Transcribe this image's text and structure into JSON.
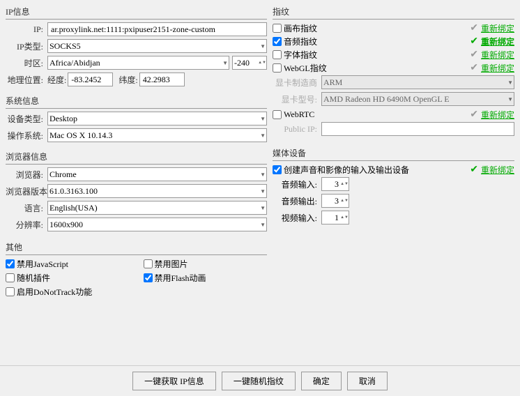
{
  "ip_section": {
    "title": "IP信息",
    "ip_label": "IP:",
    "ip_value": "ar.proxylink.net:1111:pxipuser2151-zone-custom",
    "ip_type_label": "IP类型:",
    "ip_type_value": "SOCKS5",
    "timezone_label": "时区:",
    "timezone_value": "Africa/Abidjan",
    "tz_offset": "-240",
    "geo_label": "地理位置:",
    "lon_label": "经度:",
    "lon_value": "-83.2452",
    "lat_label": "纬度:",
    "lat_value": "42.2983"
  },
  "system_section": {
    "title": "系统信息",
    "device_label": "设备类型:",
    "device_value": "Desktop",
    "os_label": "操作系统:",
    "os_value": "Mac OS X 10.14.3"
  },
  "browser_section": {
    "title": "浏览器信息",
    "browser_label": "浏览器:",
    "browser_value": "Chrome",
    "version_label": "浏览器版本:",
    "version_value": "61.0.3163.100",
    "language_label": "语言:",
    "language_value": "English(USA)",
    "resolution_label": "分辨率:",
    "resolution_value": "1600x900"
  },
  "other_section": {
    "title": "其他",
    "disable_js_label": "禁用JavaScript",
    "disable_js_checked": true,
    "disable_images_label": "禁用图片",
    "disable_images_checked": false,
    "random_plugin_label": "随机插件",
    "random_plugin_checked": false,
    "disable_flash_label": "禁用Flash动画",
    "disable_flash_checked": true,
    "dnt_label": "启用DoNotTrack功能",
    "dnt_checked": false
  },
  "fingerprint_section": {
    "title": "指纹",
    "canvas_label": "画布指纹",
    "canvas_checked": false,
    "canvas_rebind": "重新绑定",
    "audio_label": "音频指纹",
    "audio_checked": true,
    "audio_rebind": "重新绑定",
    "font_label": "字体指纹",
    "font_checked": false,
    "font_rebind": "重新绑定",
    "webgl_label": "WebGL指纹",
    "webgl_checked": false,
    "webgl_rebind": "重新绑定",
    "gpu_vendor_label": "显卡制造商",
    "gpu_vendor_value": "ARM",
    "gpu_model_label": "显卡型号:",
    "gpu_model_value": "AMD Radeon HD 6490M OpenGL E",
    "webrtc_label": "WebRTC",
    "webrtc_checked": false,
    "webrtc_rebind": "重新绑定",
    "public_ip_label": "Public IP:"
  },
  "media_section": {
    "title": "媒体设备",
    "create_label": "创建声音和影像的输入及输出设备",
    "create_checked": true,
    "create_rebind": "重新绑定",
    "audio_in_label": "音频输入:",
    "audio_in_value": "3",
    "audio_out_label": "音频输出:",
    "audio_out_value": "3",
    "video_in_label": "视频输入:",
    "video_in_value": "1"
  },
  "footer": {
    "btn1": "一键获取 IP信息",
    "btn2": "一键随机指纹",
    "btn3": "确定",
    "btn4": "取消"
  }
}
